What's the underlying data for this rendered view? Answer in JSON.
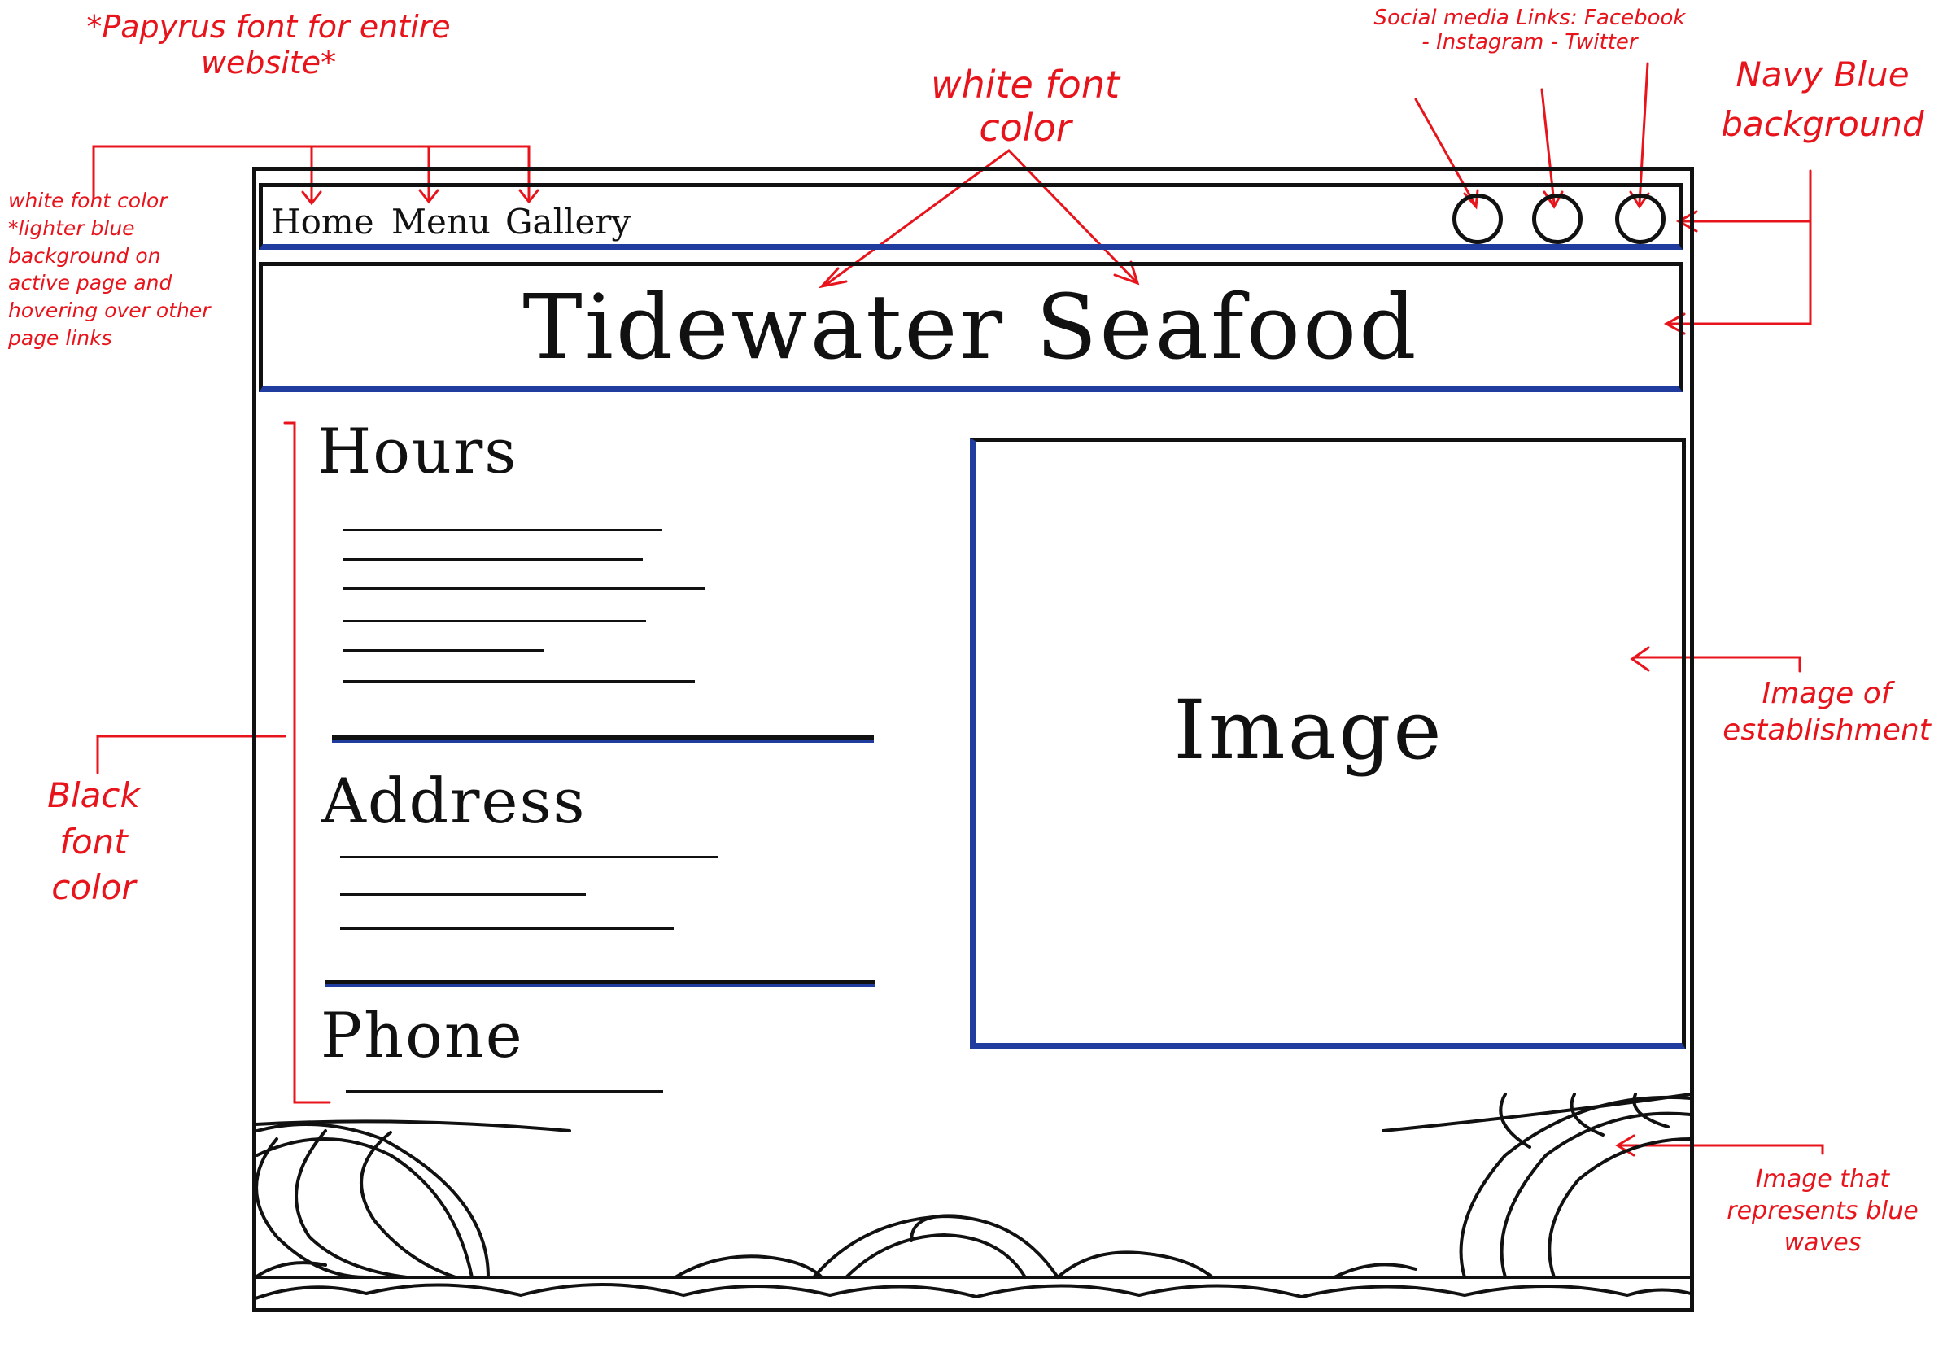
{
  "annotations": {
    "font_note": "*Papyrus font for entire website*",
    "white_font_color_title": "white font color",
    "social_media": "Social media Links: Facebook - Instagram - Twitter",
    "navy_blue": "Navy Blue background",
    "nav_note": "white font color *lighter blue background on active page and hovering over other page links",
    "black_font": "Black font color",
    "image_note": "Image of establishment",
    "waves_note": "Image that represents blue waves"
  },
  "navbar": {
    "links": [
      "Home",
      "Menu",
      "Gallery"
    ],
    "social_icons": [
      "facebook-icon",
      "instagram-icon",
      "twitter-icon"
    ]
  },
  "header": {
    "title": "Tidewater Seafood"
  },
  "sections": {
    "hours": "Hours",
    "address": "Address",
    "phone": "Phone"
  },
  "image_placeholder": "Image",
  "colors": {
    "annotation": "#e8141c",
    "ink": "#111111",
    "navy_accent": "#1f3c9e"
  }
}
